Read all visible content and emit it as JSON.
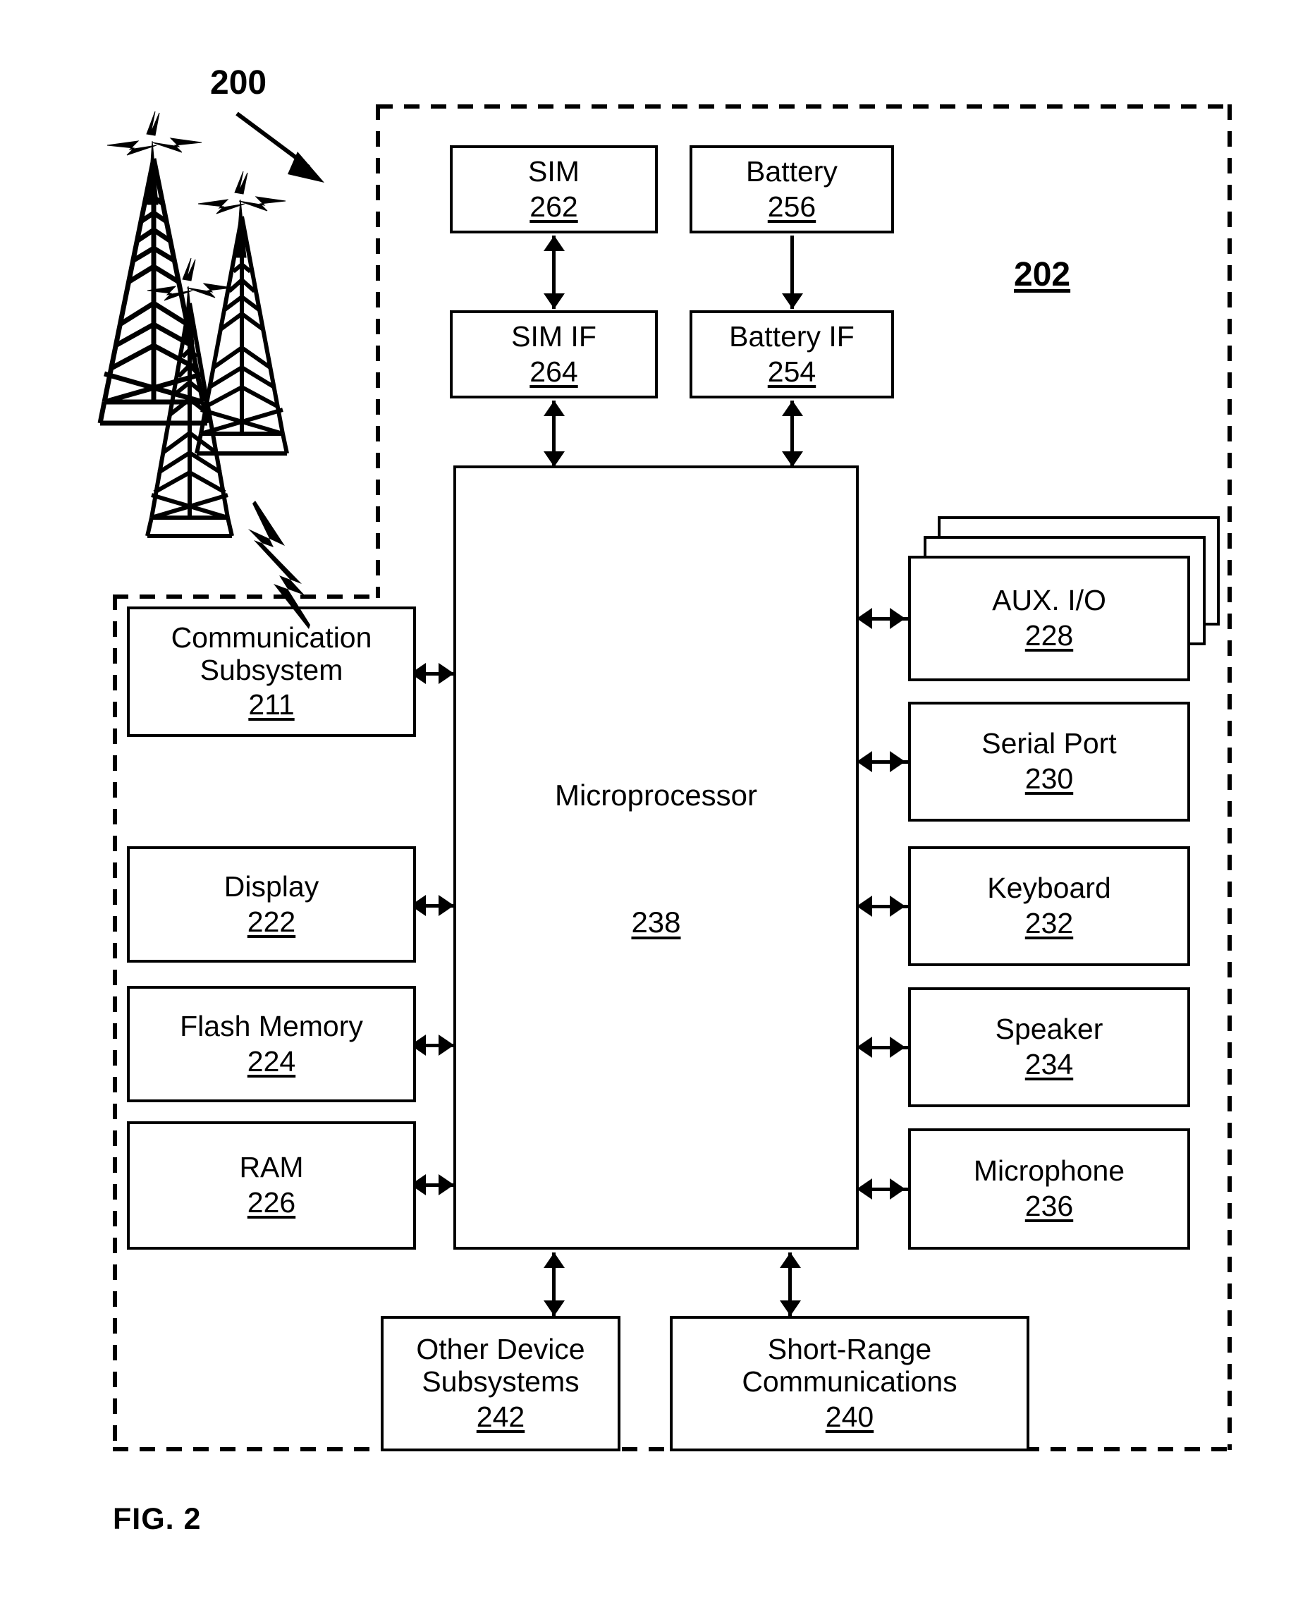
{
  "figure": {
    "caption": "FIG. 2",
    "system_ref": "200",
    "device_ref": "202"
  },
  "blocks": {
    "sim": {
      "label": "SIM",
      "ref": "262"
    },
    "battery": {
      "label": "Battery",
      "ref": "256"
    },
    "sim_if": {
      "label": "SIM IF",
      "ref": "264"
    },
    "battery_if": {
      "label": "Battery IF",
      "ref": "254"
    },
    "microprocessor": {
      "label": "Microprocessor",
      "ref": "238"
    },
    "comm_subsystem": {
      "label": "Communication\nSubsystem",
      "ref": "211"
    },
    "display": {
      "label": "Display",
      "ref": "222"
    },
    "flash": {
      "label": "Flash Memory",
      "ref": "224"
    },
    "ram": {
      "label": "RAM",
      "ref": "226"
    },
    "aux_io": {
      "label": "AUX. I/O",
      "ref": "228"
    },
    "serial_port": {
      "label": "Serial Port",
      "ref": "230"
    },
    "keyboard": {
      "label": "Keyboard",
      "ref": "232"
    },
    "speaker": {
      "label": "Speaker",
      "ref": "234"
    },
    "microphone": {
      "label": "Microphone",
      "ref": "236"
    },
    "other_device": {
      "label": "Other Device\nSubsystems",
      "ref": "242"
    },
    "short_range": {
      "label": "Short-Range\nCommunications",
      "ref": "240"
    }
  },
  "icons": {
    "tower": "cell-tower-icon",
    "lightning": "lightning-bolt-icon"
  },
  "colors": {
    "ink": "#000000",
    "paper": "#ffffff"
  }
}
